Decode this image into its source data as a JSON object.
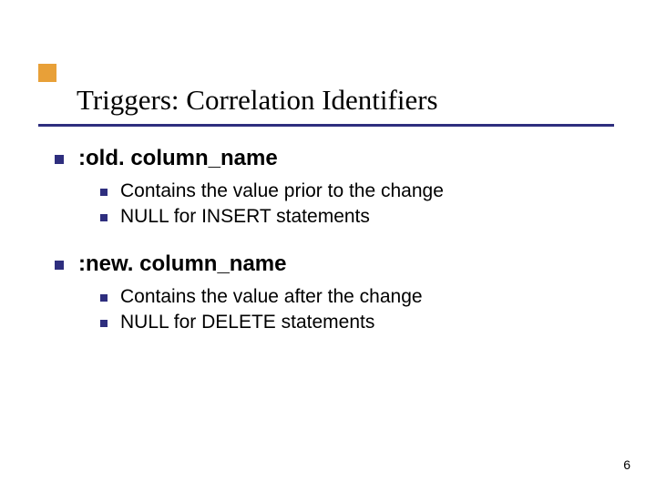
{
  "slide": {
    "title": "Triggers: Correlation Identifiers",
    "bullets": [
      {
        "label": ":old. column_name",
        "sub": [
          "Contains the value prior to the change",
          "NULL for INSERT statements"
        ]
      },
      {
        "label": ":new. column_name",
        "sub": [
          "Contains the value after the change",
          "NULL for DELETE statements"
        ]
      }
    ],
    "page_number": "6"
  }
}
